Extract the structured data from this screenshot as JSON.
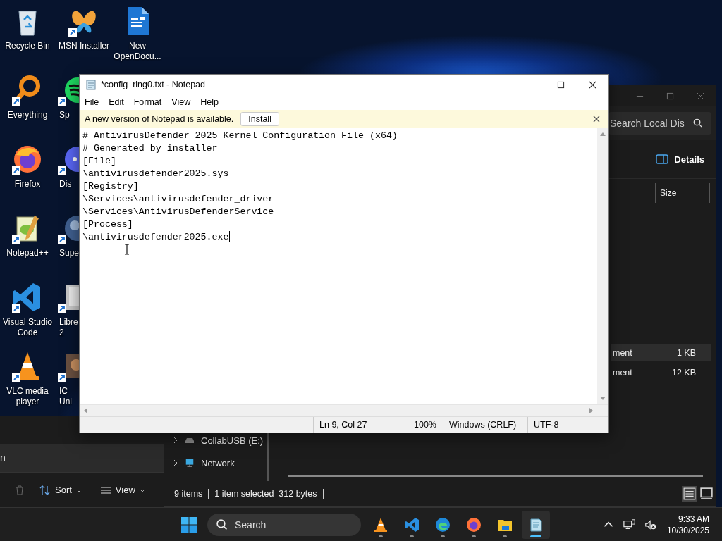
{
  "desktop_icons": [
    [
      {
        "label": "Recycle Bin",
        "kind": "recycle",
        "shortcut": false
      },
      {
        "label": "Everything",
        "kind": "everything",
        "shortcut": true
      },
      {
        "label": "Firefox",
        "kind": "firefox",
        "shortcut": true
      },
      {
        "label": "Notepad++",
        "kind": "notepadpp",
        "shortcut": true
      },
      {
        "label": "Visual Studio Code",
        "kind": "vscode",
        "shortcut": true
      },
      {
        "label": "VLC media player",
        "kind": "vlc",
        "shortcut": true
      }
    ],
    [
      {
        "label": "MSN Installer",
        "kind": "msn",
        "shortcut": true
      },
      {
        "label": "Sp",
        "kind": "spotify",
        "shortcut": true
      },
      {
        "label": "Dis",
        "kind": "discord",
        "shortcut": true
      },
      {
        "label": "Supe",
        "kind": "super",
        "shortcut": true
      },
      {
        "label": "Libre\n2",
        "kind": "libre",
        "shortcut": true
      },
      {
        "label": "IC\nUnl",
        "kind": "ic",
        "shortcut": true
      }
    ],
    [
      {
        "label": "New OpenDocu...",
        "kind": "document",
        "shortcut": false
      }
    ]
  ],
  "explorer_back": {
    "address": "n",
    "toolbar": [
      {
        "label": "Sort",
        "kind": "sort"
      },
      {
        "label": "View",
        "kind": "view"
      }
    ]
  },
  "explorer": {
    "search": {
      "placeholder": "Search Local Dis"
    },
    "details_button": "Details",
    "columns": [
      "Size"
    ],
    "rows": [
      {
        "type": "ment",
        "size": "1 KB",
        "selected": true
      },
      {
        "type": "ment",
        "size": "12 KB",
        "selected": false
      }
    ],
    "nav": [
      {
        "label": "CollabUSB (E:)",
        "kind": "drive"
      },
      {
        "label": "Network",
        "kind": "network"
      }
    ],
    "status": {
      "items": "9 items",
      "selection": "1 item selected  312 bytes"
    },
    "view_modes": [
      {
        "kind": "details",
        "selected": true
      },
      {
        "kind": "tiles",
        "selected": false
      }
    ]
  },
  "notepad": {
    "title": "*config_ring0.txt - Notepad",
    "menu": [
      "File",
      "Edit",
      "Format",
      "View",
      "Help"
    ],
    "update_bar": {
      "message": "A new version of Notepad is available.",
      "button": "Install"
    },
    "lines": [
      "# AntivirusDefender 2025 Kernel Configuration File (x64)",
      "# Generated by installer",
      "[File]",
      "\\antivirusdefender2025.sys",
      "[Registry]",
      "\\Services\\antivirusdefender_driver",
      "\\Services\\AntivirusDefenderService",
      "[Process]",
      "\\antivirusdefender2025.exe"
    ],
    "status": {
      "position": "Ln 9, Col 27",
      "zoom": "100%",
      "line_ending": "Windows (CRLF)",
      "encoding": "UTF-8"
    }
  },
  "taskbar": {
    "search": "Search",
    "apps": [
      {
        "kind": "vlc",
        "active": false
      },
      {
        "kind": "vscode",
        "active": false
      },
      {
        "kind": "edge",
        "active": false
      },
      {
        "kind": "firefox",
        "active": false
      },
      {
        "kind": "explorer",
        "active": false
      },
      {
        "kind": "notepad",
        "active": true
      }
    ],
    "time": "9:33 AM",
    "date": "10/30/2025"
  }
}
